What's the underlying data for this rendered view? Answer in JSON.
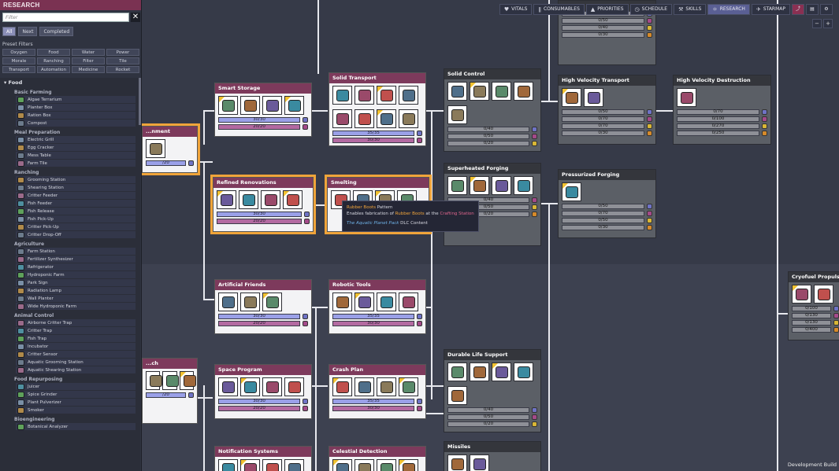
{
  "sidebar": {
    "title": "RESEARCH",
    "search_placeholder": "Filter",
    "clear_glyph": "✕",
    "tabs": [
      {
        "label": "All"
      },
      {
        "label": "Next"
      },
      {
        "label": "Completed"
      }
    ],
    "preset_label": "Preset Filters",
    "presets": [
      "Oxygen",
      "Food",
      "Water",
      "Power",
      "Morale",
      "Ranching",
      "Filter",
      "Tile",
      "Transport",
      "Automation",
      "Medicine",
      "Rocket"
    ],
    "category": "▾ Food",
    "groups": [
      {
        "name": "Basic Farming",
        "items": [
          "Algae Terrarium",
          "Planter Box",
          "Ration Box",
          "Compost"
        ]
      },
      {
        "name": "Meal Preparation",
        "items": [
          "Electric Grill",
          "Egg Cracker",
          "Mess Table",
          "Farm Tile"
        ]
      },
      {
        "name": "Ranching",
        "items": [
          "Grooming Station",
          "Shearing Station",
          "Critter Feeder",
          "Fish Feeder",
          "Fish Release",
          "Fish Pick-Up",
          "Critter Pick-Up",
          "Critter Drop-Off"
        ]
      },
      {
        "name": "Agriculture",
        "items": [
          "Farm Station",
          "Fertilizer Synthesizer",
          "Refrigerator",
          "Hydroponic Farm",
          "Park Sign",
          "Radiation Lamp",
          "Wall Planter",
          "Wide Hydroponic Farm"
        ]
      },
      {
        "name": "Animal Control",
        "items": [
          "Airborne Critter Trap",
          "Critter Trap",
          "Fish Trap",
          "Incubator",
          "Critter Sensor",
          "Aquatic Grooming Station",
          "Aquatic Shearing Station"
        ]
      },
      {
        "name": "Food Repurposing",
        "items": [
          "Juicer",
          "Spice Grinder",
          "Plant Pulverizer",
          "Smoker"
        ]
      },
      {
        "name": "Bioengineering",
        "items": [
          "Botanical Analyzer"
        ]
      }
    ]
  },
  "toolbar": {
    "buttons": [
      {
        "label": "VITALS",
        "icon": "♥"
      },
      {
        "label": "CONSUMABLES",
        "icon": "ǁ"
      },
      {
        "label": "PRIORITIES",
        "icon": "▲"
      },
      {
        "label": "SCHEDULE",
        "icon": "◷"
      },
      {
        "label": "SKILLS",
        "icon": "⚒"
      },
      {
        "label": "RESEARCH",
        "icon": "⚛"
      },
      {
        "label": "STARMAP",
        "icon": "✈"
      }
    ],
    "icon_buttons": [
      "chart-icon",
      "book-icon",
      "gear-icon"
    ],
    "zoom_out": "−",
    "zoom_in": "+"
  },
  "cards": {
    "smart_storage": {
      "title": "Smart Storage",
      "bars": [
        "30/30",
        "20/20"
      ]
    },
    "solid_transport": {
      "title": "Solid Transport",
      "bars": [
        "35/35",
        "30/30"
      ]
    },
    "solid_control": {
      "title": "Solid Control",
      "bars": [
        "0/40",
        "0/50",
        "0/20"
      ]
    },
    "top_partial": {
      "title": "",
      "bars": [
        "0/50",
        "0/50",
        "0/40",
        "0/30"
      ]
    },
    "high_velocity_transport": {
      "title": "High Velocity Transport",
      "bars": [
        "0/50",
        "0/70",
        "0/70",
        "0/30"
      ]
    },
    "high_velocity_destruction": {
      "title": "High Velocity Destruction",
      "bars": [
        "0/70",
        "0/100",
        "0/270",
        "0/250"
      ]
    },
    "containment": {
      "title": "...nment",
      "bars": [
        "/20"
      ]
    },
    "refined_renovations": {
      "title": "Refined Renovations",
      "bars": [
        "30/30",
        "20/20"
      ]
    },
    "smelting": {
      "title": "Smelting",
      "bars": []
    },
    "superheated_forging": {
      "title": "Superheated Forging",
      "bars": [
        "0/40",
        "0/50",
        "0/20"
      ]
    },
    "pressurized_forging": {
      "title": "Pressurized Forging",
      "bars": [
        "0/50",
        "0/70",
        "0/50",
        "0/30"
      ]
    },
    "artificial_friends": {
      "title": "Artificial Friends",
      "bars": [
        "30/30",
        "20/20"
      ]
    },
    "robotic_tools": {
      "title": "Robotic Tools",
      "bars": [
        "35/35",
        "30/30"
      ]
    },
    "cryofuel_propulsion": {
      "title": "Cryofuel Propulsion",
      "bars": [
        "0/100",
        "0/130",
        "0/130",
        "0/400"
      ]
    },
    "partial_left": {
      "title": "...ch",
      "bars": [
        "/20"
      ]
    },
    "space_program": {
      "title": "Space Program",
      "bars": [
        "30/30",
        "20/20"
      ]
    },
    "crash_plan": {
      "title": "Crash Plan",
      "bars": [
        "35/35",
        "30/30"
      ]
    },
    "durable_life_support": {
      "title": "Durable Life Support",
      "bars": [
        "0/40",
        "0/50",
        "0/20"
      ]
    },
    "notification_systems": {
      "title": "Notification Systems",
      "bars": []
    },
    "celestial_detection": {
      "title": "Celestial Detection",
      "bars": []
    },
    "missiles": {
      "title": "Missiles",
      "bars": []
    }
  },
  "tooltip": {
    "item": "Rubber Boots",
    "suffix": " Pattern",
    "line2_a": "Enables fabrication of ",
    "line2_item": "Rubber Boots",
    "line2_b": " at the ",
    "line2_station": "Crafting Station",
    "dlc_link": "The Aquatic Planet Pack",
    "dlc_suffix": " DLC Content"
  },
  "footer": {
    "dev_build": "Development Build"
  },
  "colors": {
    "accent": "#f0a43a",
    "title_bar": "#7d3a5c",
    "bar_blue": "#9aa0e8",
    "bar_pink": "#b36aa1"
  }
}
